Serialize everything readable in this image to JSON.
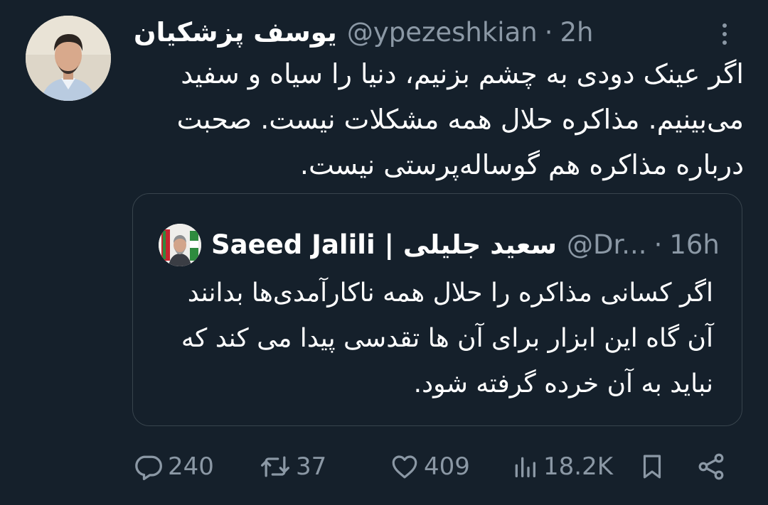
{
  "author": {
    "name": "یوسف پزشکیان",
    "handle": "@ypezeshkian",
    "time": "2h"
  },
  "separator": "·",
  "tweet_text": "اگر عینک دودی به چشم بزنیم، دنیا را سیاه و سفید می‌بینیم. مذاکره حلال همه مشکلات نیست. صحبت درباره مذاکره هم گوساله‌پرستی نیست.",
  "quoted": {
    "name": "Saeed Jalili | سعید جلیلی",
    "handle": "@Dr...",
    "time": "16h",
    "text": "اگر کسانی مذاکره را حلال همه ناکارآمدی‌ها بدانند آن گاه این ابزار برای آن ها تقدسی پیدا می کند که نباید به آن خرده گرفته شود."
  },
  "actions": {
    "replies": "240",
    "retweets": "37",
    "likes": "409",
    "views": "18.2K"
  },
  "icons": {
    "more": "more-vertical-icon",
    "reply": "reply-icon",
    "retweet": "retweet-icon",
    "like": "heart-icon",
    "views": "views-chart-icon",
    "bookmark": "bookmark-icon",
    "share": "share-icon"
  },
  "colors": {
    "background": "#15202b",
    "text": "#ffffff",
    "secondary": "#8b98a5",
    "border": "#38444d"
  }
}
